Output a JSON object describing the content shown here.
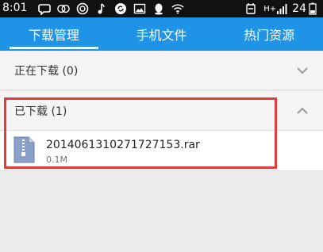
{
  "status_bar": {
    "time": "8:01",
    "network": "H+",
    "battery": "24"
  },
  "tabs": [
    {
      "label": "下载管理",
      "active": true
    },
    {
      "label": "手机文件",
      "active": false
    },
    {
      "label": "热门资源",
      "active": false
    }
  ],
  "groups": {
    "downloading": {
      "label": "正在下载 (0)",
      "expanded": false
    },
    "downloaded": {
      "label": "已下载 (1)",
      "expanded": true
    }
  },
  "files": [
    {
      "name": "2014061310271727153.rar",
      "size": "0.1M",
      "icon": "archive-zip-icon"
    }
  ],
  "colors": {
    "accent": "#1f93e6",
    "highlight": "#e23b3b"
  }
}
